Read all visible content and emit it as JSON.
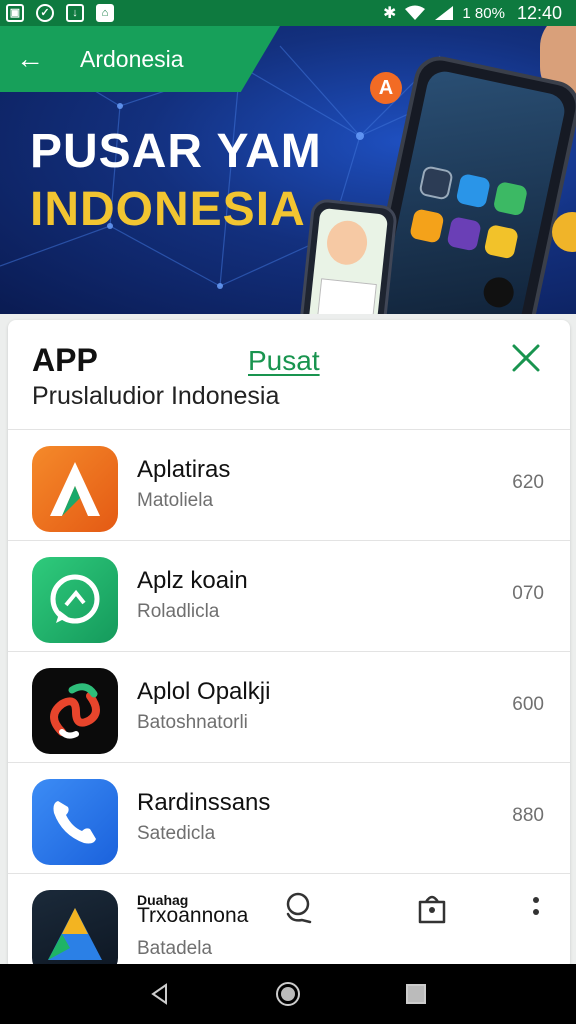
{
  "status_bar": {
    "battery": "1 80%",
    "time": "12:40",
    "left_icons": [
      "photo-icon",
      "message-icon",
      "download-icon",
      "home-icon"
    ],
    "right_icons": [
      "bluetooth-icon",
      "wifi-icon",
      "signal-icon"
    ]
  },
  "hero": {
    "title": "Ardonesia",
    "headline_1": "PUSAR YAM",
    "headline_2": "INDONESIA",
    "badge": "A"
  },
  "card": {
    "title": "APP",
    "link": "Pusat",
    "subtitle": "Pruslaludior Indonesia",
    "accent_color": "#19944f"
  },
  "apps": [
    {
      "name": "Aplatiras",
      "sub": "Matoliela",
      "value": "620",
      "icon": "orange-a-icon"
    },
    {
      "name": "Aplz koain",
      "sub": "Roladlicla",
      "value": "070",
      "icon": "green-chat-icon"
    },
    {
      "name": "Aplol Opalkji",
      "sub": "Batoshnatorli",
      "value": "600",
      "icon": "swirl-icon"
    },
    {
      "name": "Rardinssans",
      "sub": "Satedicla",
      "value": "880",
      "icon": "phone-icon"
    },
    {
      "name": "Trxoannona",
      "sub": "Batadela",
      "value": "",
      "icon": "triangle-a-icon",
      "overline": "Duahag"
    }
  ],
  "toolbar_icons": [
    "touch-icon",
    "bag-icon",
    "more-icon"
  ],
  "nav": [
    "back-icon",
    "home-icon",
    "recents-icon"
  ]
}
